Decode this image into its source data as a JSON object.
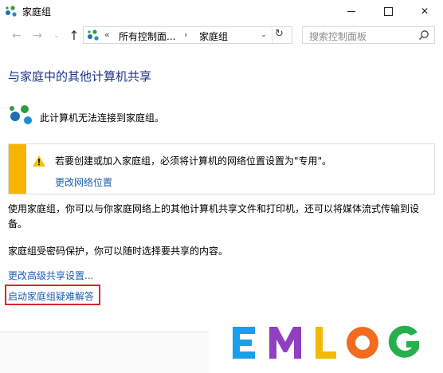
{
  "window": {
    "title": "家庭组",
    "minimize_icon": "minimize-icon",
    "maximize_icon": "maximize-icon",
    "close_icon": "close-icon",
    "close_glyph": "✕"
  },
  "nav": {
    "back_glyph": "←",
    "forward_glyph": "→",
    "recent_glyph": "⌄",
    "up_glyph": "↑"
  },
  "address": {
    "overflow": "«",
    "crumb_1": "所有控制面...",
    "separator": "›",
    "crumb_2": "家庭组",
    "dropdown_glyph": "⌄",
    "refresh_glyph": "↻"
  },
  "search": {
    "placeholder": "搜索控制面板"
  },
  "main": {
    "heading": "与家庭中的其他计算机共享",
    "status": "此计算机无法连接到家庭组。",
    "warning": {
      "text": "若要创建或加入家庭组，必须将计算机的网络位置设置为\"专用\"。",
      "link": "更改网络位置"
    },
    "description": "使用家庭组，你可以与你家庭网络上的其他计算机共享文件和打印机，还可以将媒体流式传输到设备。",
    "password_note": "家庭组受密码保护，你可以随时选择要共享的内容。",
    "links": {
      "advanced_sharing": "更改高级共享设置...",
      "troubleshoot": "启动家庭组疑难解答"
    }
  },
  "watermark": {
    "letters": [
      "E",
      "M",
      "L",
      "O",
      "G"
    ],
    "colors": [
      "#1aa0e8",
      "#8f3fc0",
      "#f2b900",
      "#f36b21",
      "#25b04b"
    ]
  },
  "colors": {
    "heading": "#1e3287",
    "link": "#1a5fb4",
    "warning_stripe": "#f7b500",
    "highlight_border": "#d9272e"
  }
}
